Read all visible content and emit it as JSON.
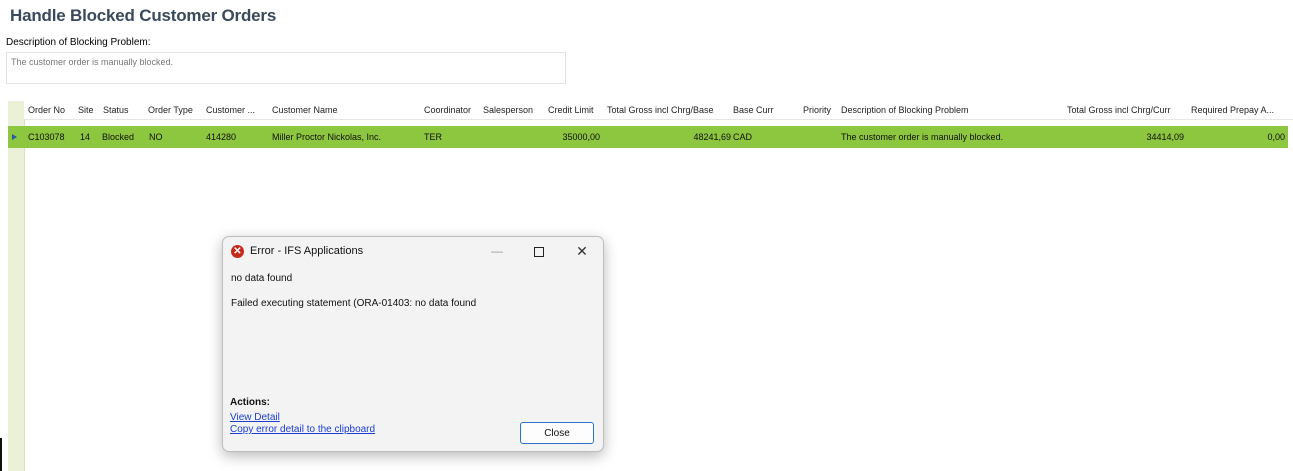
{
  "page": {
    "title": "Handle Blocked Customer Orders",
    "description_label": "Description of Blocking Problem:",
    "description_value": "The customer order is manually blocked."
  },
  "grid": {
    "columns": [
      "Order No",
      "Site",
      "Status",
      "Order Type",
      "Customer ...",
      "Customer Name",
      "Coordinator",
      "Salesperson",
      "Credit Limit",
      "Total Gross incl Chrg/Base",
      "Base Curr",
      "Priority",
      "Description of Blocking Problem",
      "Total Gross incl Chrg/Curr",
      "Required Prepay A..."
    ],
    "rows": [
      {
        "order_no": "C103078",
        "site": "14",
        "status": "Blocked",
        "order_type": "NO",
        "customer_no": "414280",
        "customer_name": "Miller Proctor Nickolas, Inc.",
        "coordinator": "TER",
        "salesperson": "",
        "credit_limit": "35000,00",
        "total_gross_base": "48241,69",
        "base_curr": "CAD",
        "priority": "",
        "blocking_description": "The customer order is manually blocked.",
        "total_gross_curr": "34414,09",
        "required_prepay": "0,00"
      }
    ],
    "selected_row_color": "#8dc63f"
  },
  "dialog": {
    "title": "Error - IFS Applications",
    "icon": "error-icon",
    "minimize": "—",
    "close_glyph": "✕",
    "message": "no data found",
    "detail": "Failed executing statement (ORA-01403: no data found",
    "actions_label": "Actions:",
    "links": [
      "View Detail",
      "Copy error detail to the clipboard"
    ],
    "close_button": "Close"
  }
}
